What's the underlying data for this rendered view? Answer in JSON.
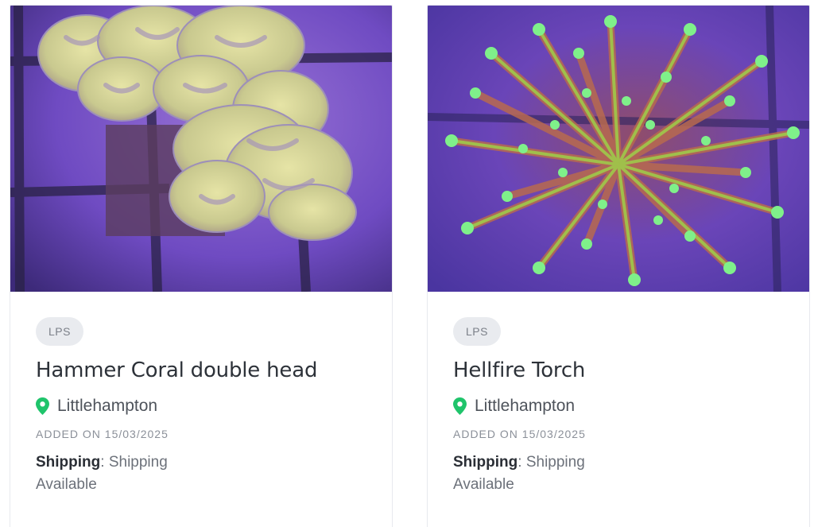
{
  "listings": [
    {
      "category": "LPS",
      "title": "Hammer Coral double head",
      "location": "Littlehampton",
      "added": "ADDED ON 15/03/2025",
      "shipping_label": "Shipping",
      "shipping_value": "Shipping Available",
      "image_icon": "coral-photo"
    },
    {
      "category": "LPS",
      "title": "Hellfire Torch",
      "location": "Littlehampton",
      "added": "ADDED ON 15/03/2025",
      "shipping_label": "Shipping",
      "shipping_value": "Shipping Available",
      "image_icon": "coral-photo"
    }
  ],
  "colors": {
    "pin": "#1fc46b",
    "tag_bg": "#e9ebef",
    "title": "#2d3239"
  }
}
